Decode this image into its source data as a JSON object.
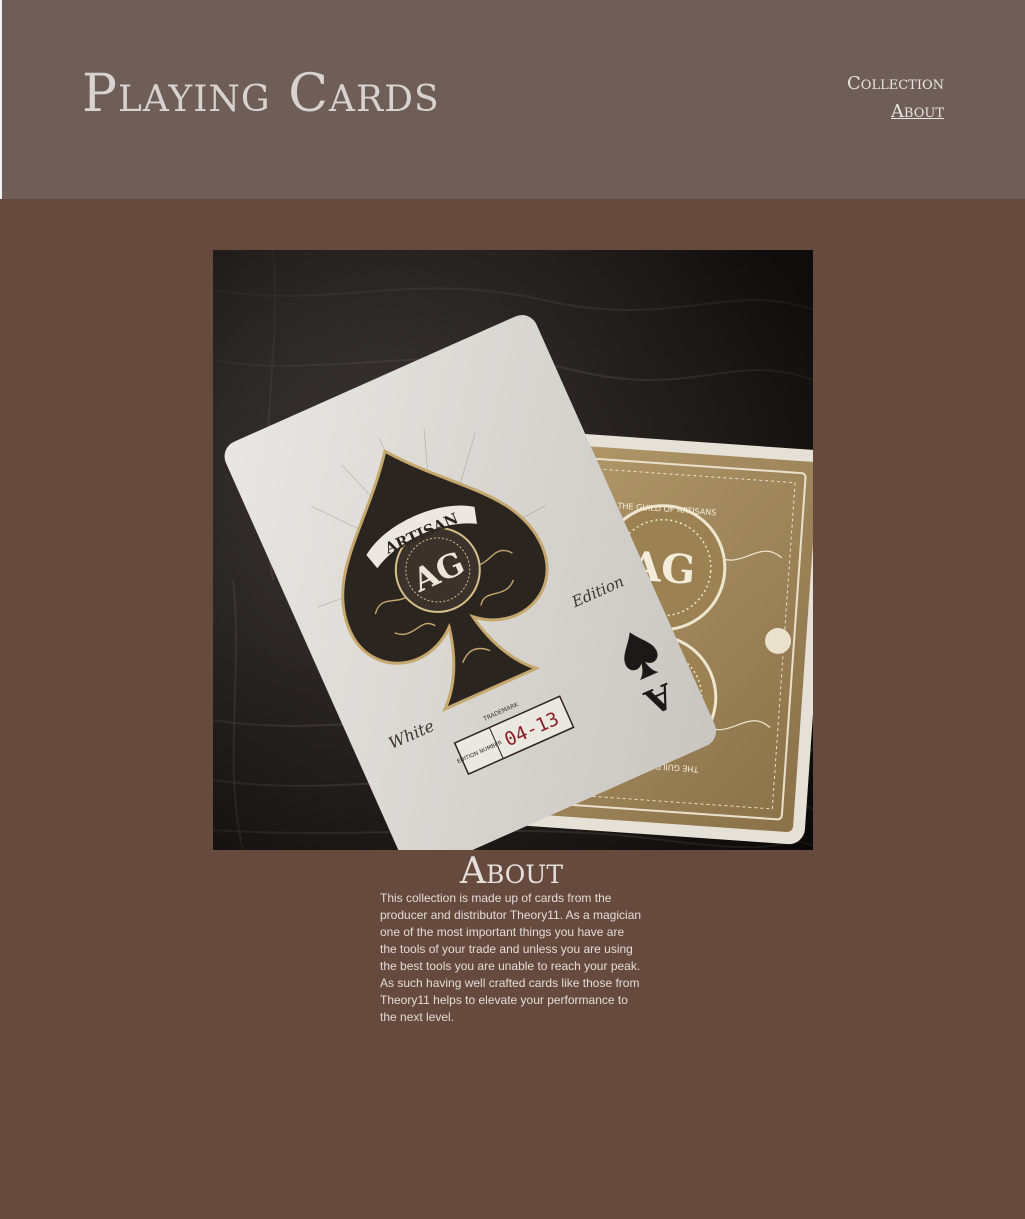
{
  "header": {
    "title": "Playing Cards",
    "nav": [
      {
        "label": "Collection",
        "active": false
      },
      {
        "label": "About",
        "active": true
      }
    ]
  },
  "hero": {
    "description": "Photo of two Artisan playing cards on a wooden surface",
    "card_labels": {
      "banner": "ARTISAN",
      "edition_right": "Edition",
      "edition_left": "White",
      "trademark": "TRADEMARK",
      "edition_number_label": "EDITION NUMBER",
      "edition_number": "04-13",
      "corner_rank": "A",
      "back_ring_top": "THE GUILD OF ARTISANS",
      "back_ring_bottom": "THE GUILD OF ARTISANS"
    }
  },
  "about": {
    "heading": "About",
    "body": "This collection is made up of cards from the producer and distributor Theory11. As a magician one of the most important things you have are the tools of your trade and unless you are using the best tools you are unable to reach your peak. As such having well crafted cards like those from Theory11 helps to elevate your performance to the next level."
  },
  "colors": {
    "page_background": "#674a3e",
    "header_background": "#6e5e57",
    "title_text": "#d8d3d0",
    "body_text": "#e2dcd8",
    "gold": "#a88a5a"
  }
}
